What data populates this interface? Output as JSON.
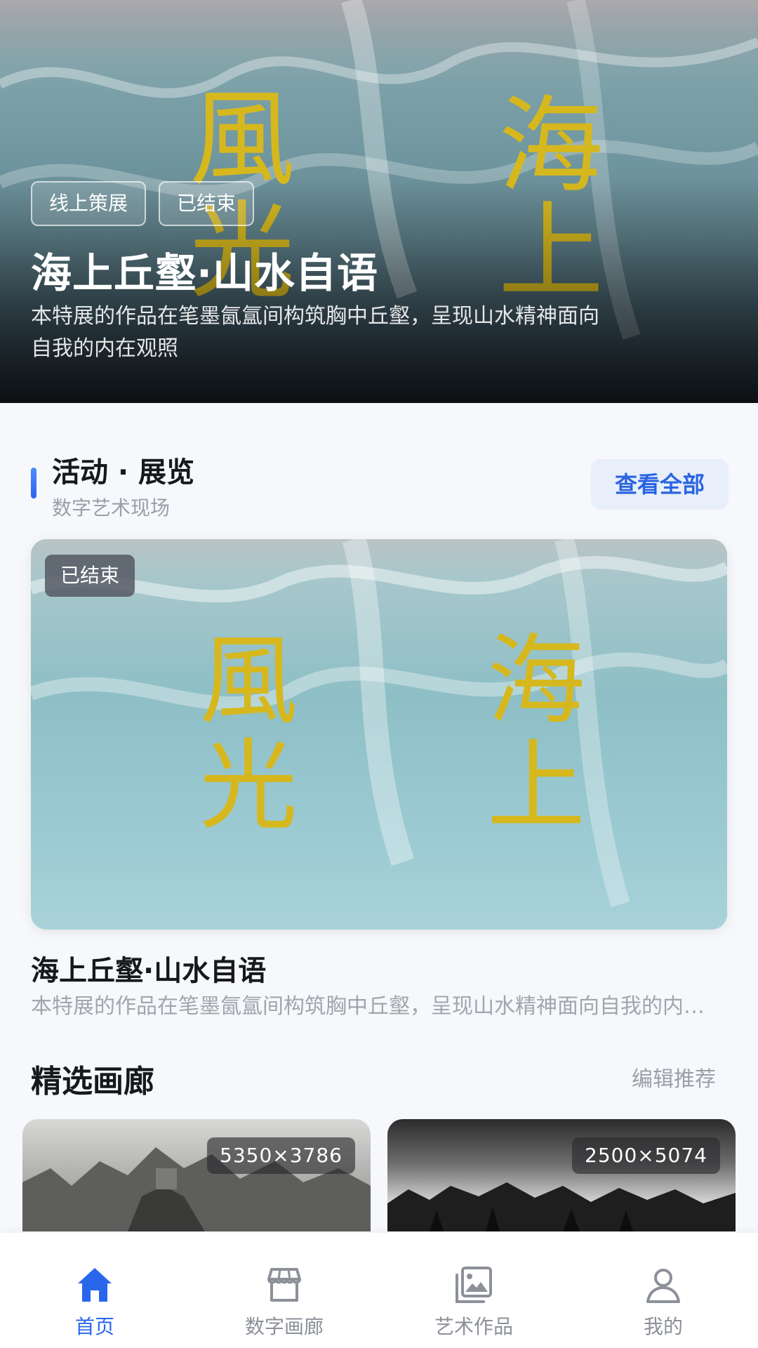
{
  "hero": {
    "tags": [
      "线上策展",
      "已结束"
    ],
    "title": "海上丘壑·山水自语",
    "description": "本特展的作品在笔墨氤氲间构筑胸中丘壑，呈现山水精神面向自我的内在观照",
    "artwork_text": [
      "風",
      "光",
      "海",
      "上"
    ]
  },
  "events_section": {
    "title": "活动 · 展览",
    "subtitle": "数字艺术现场",
    "view_all_label": "查看全部"
  },
  "exhibition_card": {
    "badge": "已结束",
    "artwork_text": [
      "風",
      "光",
      "海",
      "上"
    ],
    "title": "海上丘壑·山水自语",
    "description": "本特展的作品在笔墨氤氲间构筑胸中丘壑，呈现山水精神面向自我的内在观照"
  },
  "gallery_section": {
    "title": "精选画廊",
    "edit_label": "编辑推荐",
    "items": [
      {
        "dimensions": "5350×3786"
      },
      {
        "dimensions": "2500×5074"
      }
    ]
  },
  "tabbar": {
    "tabs": [
      {
        "label": "首页",
        "icon": "home-icon",
        "active": true
      },
      {
        "label": "数字画廊",
        "icon": "store-icon",
        "active": false
      },
      {
        "label": "艺术作品",
        "icon": "gallery-icon",
        "active": false
      },
      {
        "label": "我的",
        "icon": "user-icon",
        "active": false
      }
    ]
  },
  "colors": {
    "accent": "#2a66ec",
    "calligraphy_gold": "#d6b81e"
  }
}
